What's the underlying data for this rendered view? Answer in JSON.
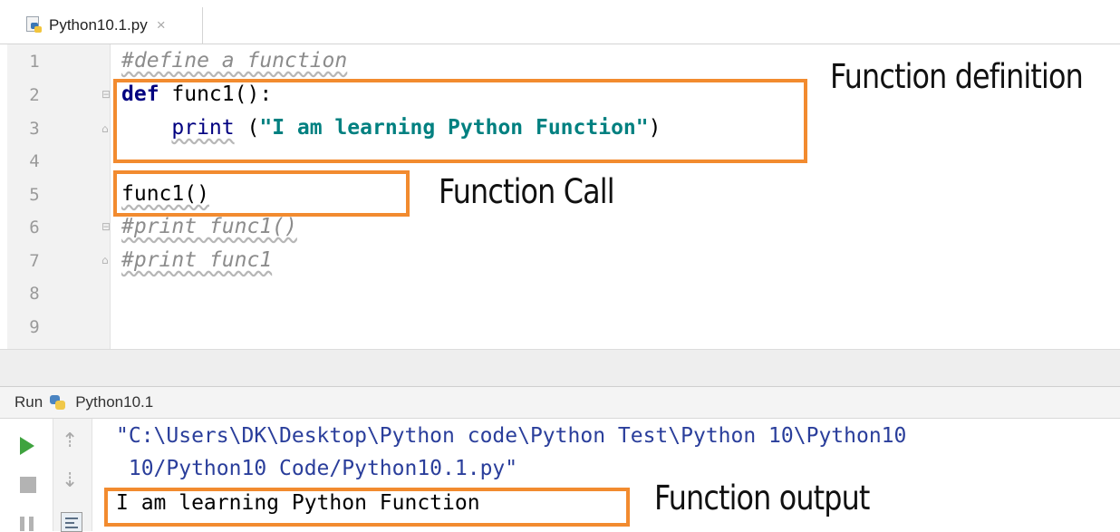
{
  "tab": {
    "label": "Python10.1.py",
    "close_glyph": "×"
  },
  "editor": {
    "line_numbers": [
      "1",
      "2",
      "3",
      "4",
      "5",
      "6",
      "7",
      "8",
      "9"
    ],
    "code": {
      "l1": "#define a function",
      "l2_kw": "def",
      "l2_rest": " func1():",
      "l3_builtin": "print",
      "l3_open": " (",
      "l3_str": "\"I am learning Python Function\"",
      "l3_close": ")",
      "l5": "func1()",
      "l6": "#print func1()",
      "l7": "#print func1"
    }
  },
  "run": {
    "label": "Run",
    "config": "Python10.1",
    "output": {
      "path_line1": "\"C:\\Users\\DK\\Desktop\\Python code\\Python Test\\Python 10\\Python10",
      "path_line2": " 10/Python10 Code/Python10.1.py\"",
      "result": "I am learning Python Function"
    }
  },
  "annotations": {
    "definition": "Function definition",
    "call": "Function Call",
    "output": "Function output"
  },
  "colors": {
    "annotation_box": "#f28b2f",
    "keyword": "#000080",
    "string": "#008080",
    "comment": "#8c8c8c",
    "path": "#2a3e9b",
    "run_green": "#3fa33f"
  },
  "icons": [
    "python-file-icon",
    "close-icon",
    "python-icon",
    "run-icon",
    "stop-icon",
    "pause-icon",
    "up-arrow-icon",
    "down-arrow-icon",
    "soft-wrap-icon"
  ]
}
